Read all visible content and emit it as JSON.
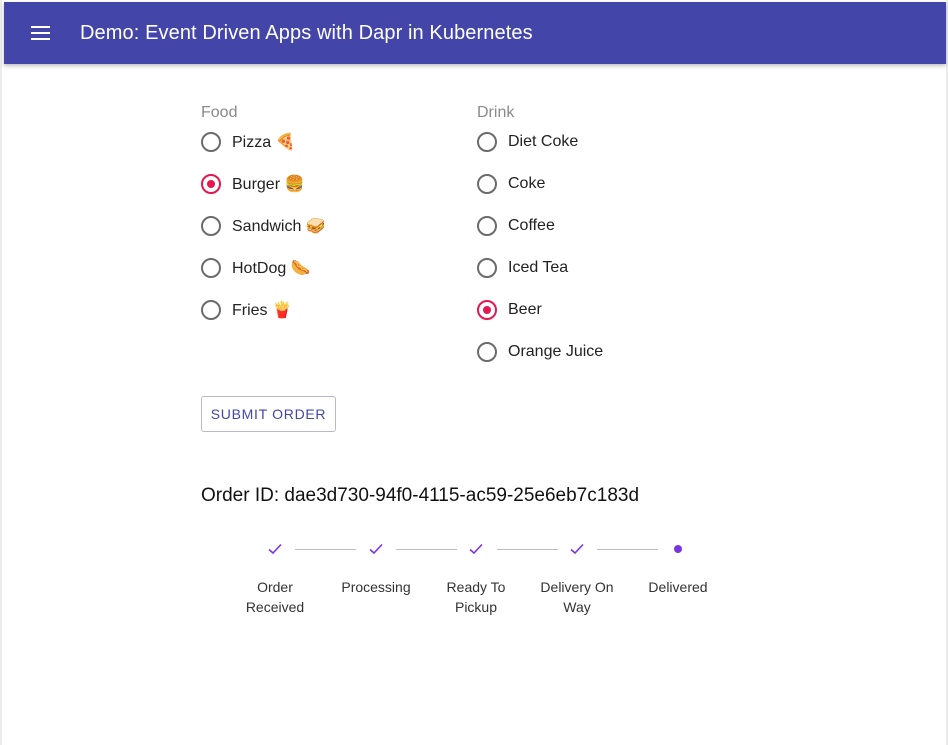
{
  "app": {
    "title": "Demo: Event Driven Apps with Dapr in Kubernetes",
    "menu_icon": "menu-icon"
  },
  "food": {
    "label": "Food",
    "options": [
      {
        "label": "Pizza 🍕",
        "checked": false
      },
      {
        "label": "Burger 🍔",
        "checked": true
      },
      {
        "label": "Sandwich 🥪",
        "checked": false
      },
      {
        "label": "HotDog 🌭",
        "checked": false
      },
      {
        "label": "Fries 🍟",
        "checked": false
      }
    ]
  },
  "drink": {
    "label": "Drink",
    "options": [
      {
        "label": "Diet Coke",
        "checked": false
      },
      {
        "label": "Coke",
        "checked": false
      },
      {
        "label": "Coffee",
        "checked": false
      },
      {
        "label": "Iced Tea",
        "checked": false
      },
      {
        "label": "Beer",
        "checked": true
      },
      {
        "label": "Orange Juice",
        "checked": false
      }
    ]
  },
  "submit_label": "SUBMIT ORDER",
  "order": {
    "text": "Order ID: dae3d730-94f0-4115-ac59-25e6eb7c183d"
  },
  "steps": [
    {
      "label": "Order Received",
      "state": "complete"
    },
    {
      "label": "Processing",
      "state": "complete"
    },
    {
      "label": "Ready To Pickup",
      "state": "complete"
    },
    {
      "label": "Delivery On Way",
      "state": "complete"
    },
    {
      "label": "Delivered",
      "state": "current"
    }
  ],
  "colors": {
    "appbar": "#4345a9",
    "radio_checked": "#e5174f",
    "stepper_accent": "#7b34e4"
  }
}
